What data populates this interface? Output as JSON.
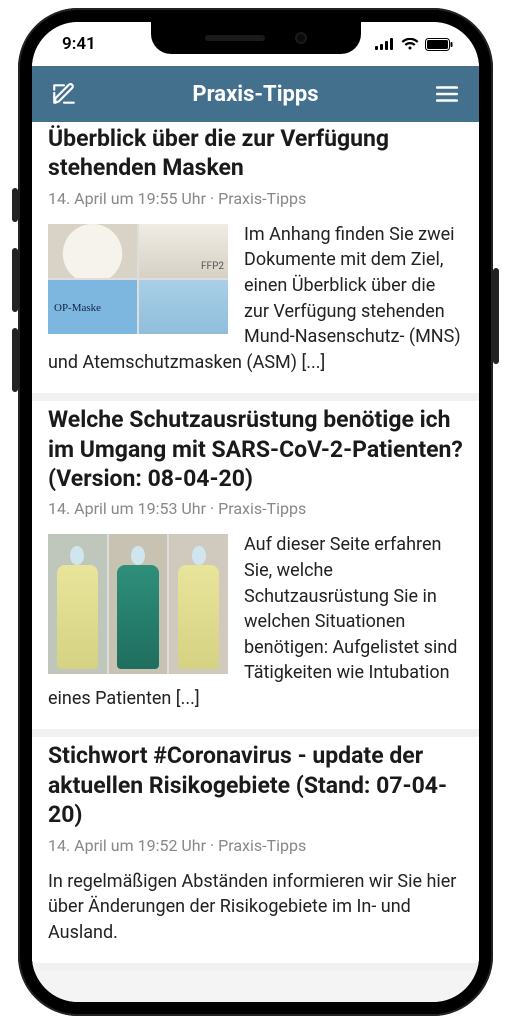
{
  "statusbar": {
    "time": "9:41"
  },
  "navbar": {
    "title": "Praxis-Tipps"
  },
  "posts": [
    {
      "title": "Überblick über die zur Verfügung stehenden Masken",
      "meta": "14. April um 19:55 Uhr · Praxis-Tipps",
      "excerpt": "Im Anhang finden Sie zwei Dokumente mit dem Ziel, einen Überblick über die zur Verfügung stehenden Mund-Nasenschutz- (MNS) und Atemschutzmasken (ASM) [...]",
      "thumb": "masks"
    },
    {
      "title": "Welche Schutzausrüstung benötige ich im Umgang mit SARS-CoV-2-Patienten? (Version: 08-04-20)",
      "meta": "14. April um 19:53 Uhr · Praxis-Tipps",
      "excerpt": "Auf dieser Seite erfahren Sie, welche Schutzausrüstung Sie in welchen Situationen benötigen: Aufgelistet sind Tätigkeiten wie Intubation eines Patienten [...]",
      "thumb": "ppe"
    },
    {
      "title": "Stichwort #Coronavirus - update der aktuellen Risikogebiete (Stand: 07-04-20)",
      "meta": "14. April um 19:52 Uhr · Praxis-Tipps",
      "excerpt": "In regelmäßigen Abständen informieren wir Sie hier über Änderungen der Risikogebiete im In- und Ausland.",
      "thumb": null
    }
  ]
}
